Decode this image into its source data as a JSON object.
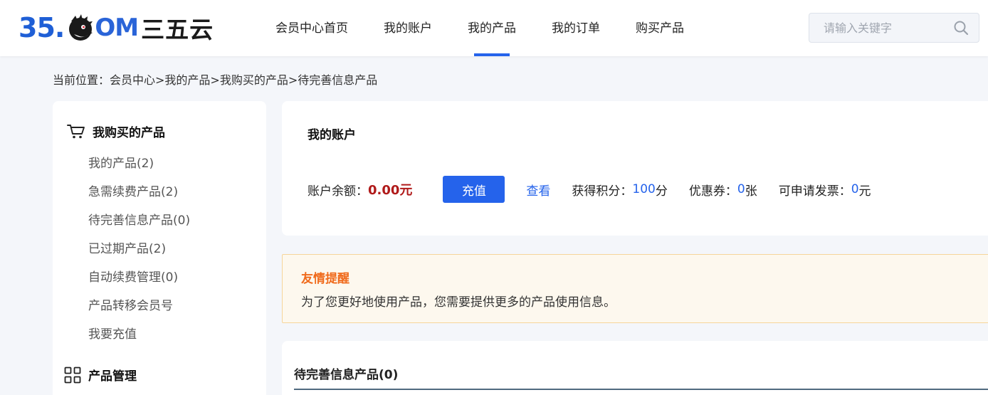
{
  "brand": {
    "logo_num": "35.",
    "logo_om": "OM",
    "logo_cn": "三五云",
    "accent": "#2563eb"
  },
  "nav": {
    "items": [
      {
        "label": "会员中心首页"
      },
      {
        "label": "我的账户"
      },
      {
        "label": "我的产品",
        "active": true
      },
      {
        "label": "我的订单"
      },
      {
        "label": "购买产品"
      }
    ]
  },
  "search": {
    "placeholder": "请输入关键字",
    "icon": "search-icon"
  },
  "breadcrumb": "当前位置：会员中心>我的产品>我购买的产品>待完善信息产品",
  "sidebar": {
    "group1_title": "我购买的产品",
    "group1_icon": "cart-icon",
    "items": [
      {
        "label": "我的产品(2)"
      },
      {
        "label": "急需续费产品(2)"
      },
      {
        "label": "待完善信息产品(0)"
      },
      {
        "label": "已过期产品(2)"
      },
      {
        "label": "自动续费管理(0)"
      },
      {
        "label": "产品转移会员号"
      },
      {
        "label": "我要充值"
      }
    ],
    "group2_title": "产品管理",
    "group2_icon": "grid-icon"
  },
  "account": {
    "title": "我的账户",
    "balance_label": "账户余额：",
    "balance_value": "0.00元",
    "recharge_button": "充值",
    "view_link": "查看",
    "points_label": "获得积分：",
    "points_value": "100",
    "points_unit": "分",
    "coupon_label": "优惠券：",
    "coupon_value": "0",
    "coupon_unit": "张",
    "invoice_label": "可申请发票：",
    "invoice_value": "0",
    "invoice_unit": "元"
  },
  "notice": {
    "title": "友情提醒",
    "text": "为了您更好地使用产品，您需要提供更多的产品使用信息。"
  },
  "list": {
    "title": "待完善信息产品(0)"
  }
}
